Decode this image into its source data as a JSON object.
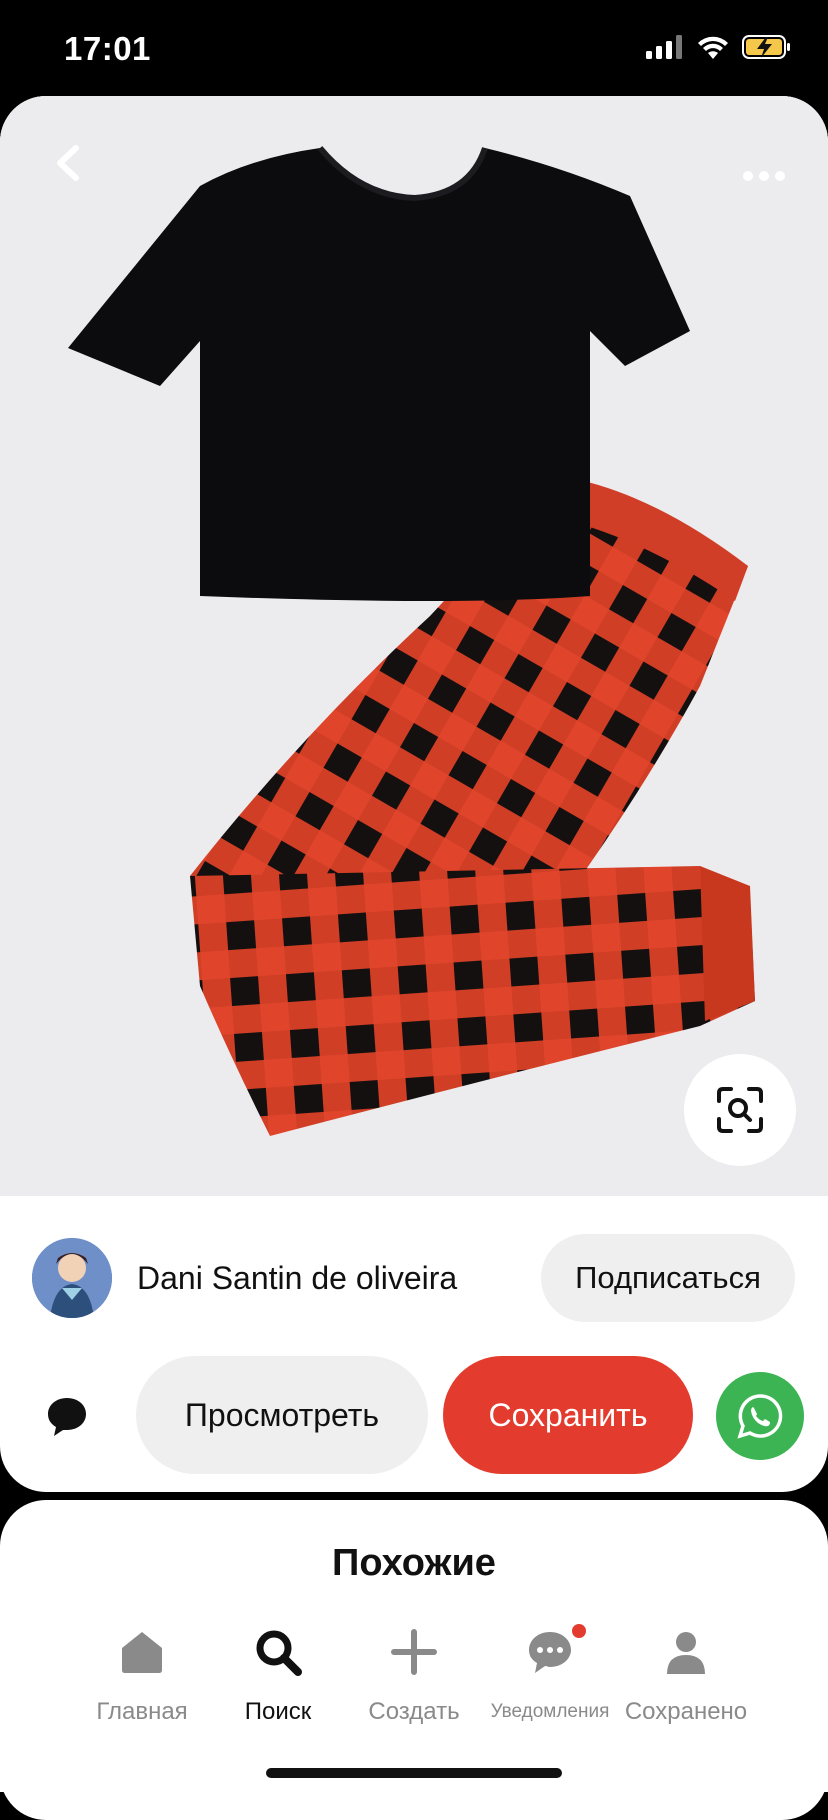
{
  "status_bar": {
    "time": "17:01",
    "icons": [
      "signal-icon",
      "wifi-icon",
      "battery-charging-icon"
    ]
  },
  "pin": {
    "image_icons": [
      "back-chevron-icon",
      "more-dots-icon",
      "visual-search-icon"
    ],
    "creator": {
      "name": "Dani Santin de oliveira",
      "follow_label": "Подписаться"
    },
    "actions": {
      "visit_label": "Просмотреть",
      "save_label": "Сохранить",
      "comment_icon": "comment-bubble-icon",
      "share_icon": "whatsapp-icon"
    }
  },
  "similar": {
    "title": "Похожие"
  },
  "tab_bar": {
    "items": [
      {
        "label": "Главная",
        "icon": "home-icon",
        "active": false
      },
      {
        "label": "Поиск",
        "icon": "search-icon",
        "active": true
      },
      {
        "label": "Создать",
        "icon": "plus-icon",
        "active": false
      },
      {
        "label": "Уведомления",
        "icon": "chat-bubble-icon",
        "active": false,
        "badge": true
      },
      {
        "label": "Сохранено",
        "icon": "profile-icon",
        "active": false
      }
    ]
  },
  "colors": {
    "save_button": "#e33b2e",
    "whatsapp": "#3cb453",
    "plaid_red": "#e0452c",
    "background": "#000000"
  }
}
